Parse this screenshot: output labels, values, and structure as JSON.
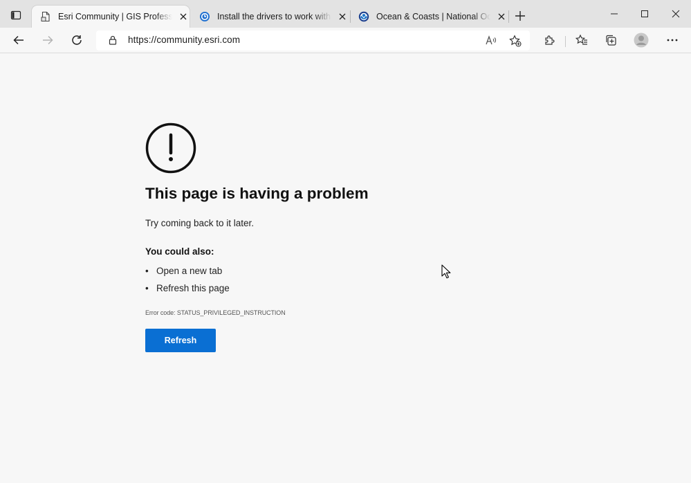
{
  "browser": {
    "tabs": [
      {
        "title": "Esri Community | GIS Professiona",
        "active": true,
        "favicon": "page-icon"
      },
      {
        "title": "Install the drivers to work with M",
        "active": false,
        "favicon": "globe-blue-icon"
      },
      {
        "title": "Ocean & Coasts | National Ocean",
        "active": false,
        "favicon": "noaa-logo-icon"
      }
    ],
    "url": "https://community.esri.com",
    "accent_color": "#0a6fd3"
  },
  "error_page": {
    "title": "This page is having a problem",
    "subtitle": "Try coming back to it later.",
    "also_heading": "You could also:",
    "suggestions": [
      "Open a new tab",
      "Refresh this page"
    ],
    "error_code": "Error code: STATUS_PRIVILEGED_INSTRUCTION",
    "refresh_label": "Refresh"
  }
}
